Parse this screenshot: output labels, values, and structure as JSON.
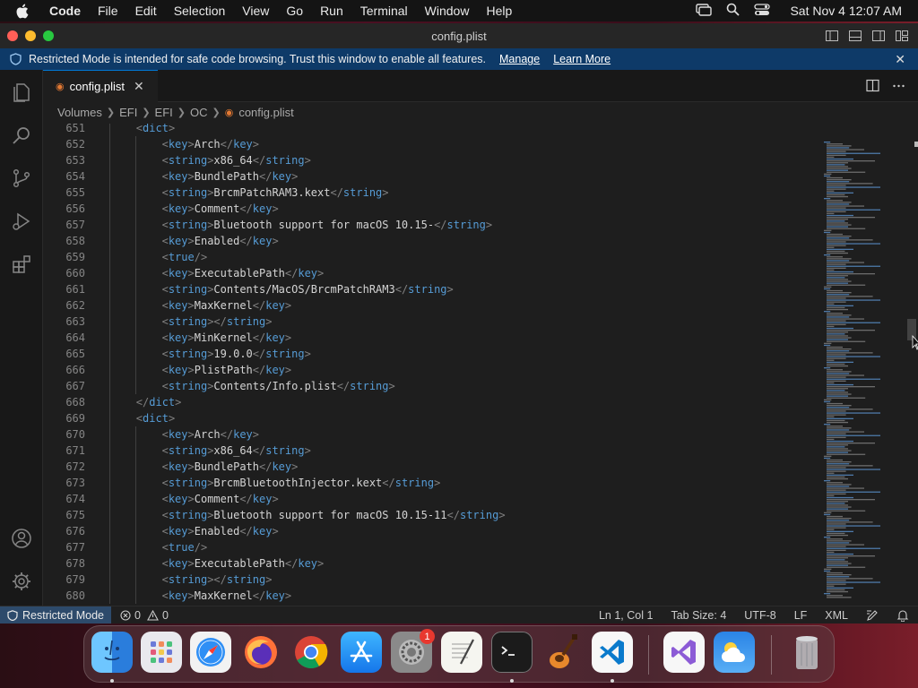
{
  "menubar": {
    "app": "Code",
    "items": [
      "File",
      "Edit",
      "Selection",
      "View",
      "Go",
      "Run",
      "Terminal",
      "Window",
      "Help"
    ],
    "clock": "Sat Nov 4  12:07 AM"
  },
  "window": {
    "title": "config.plist"
  },
  "banner": {
    "message": "Restricted Mode is intended for safe code browsing. Trust this window to enable all features.",
    "manage": "Manage",
    "learn_more": "Learn More"
  },
  "tab": {
    "label": "config.plist"
  },
  "breadcrumb": [
    "Volumes",
    "EFI",
    "EFI",
    "OC",
    "config.plist"
  ],
  "lines": [
    {
      "n": "651",
      "indent": 1,
      "parts": [
        [
          "tag",
          "<"
        ],
        [
          "tname",
          "dict"
        ],
        [
          "tag",
          ">"
        ]
      ]
    },
    {
      "n": "652",
      "indent": 2,
      "parts": [
        [
          "tag",
          "<"
        ],
        [
          "tname",
          "key"
        ],
        [
          "tag",
          ">"
        ],
        [
          "txt",
          "Arch"
        ],
        [
          "tag",
          "</"
        ],
        [
          "tname",
          "key"
        ],
        [
          "tag",
          ">"
        ]
      ]
    },
    {
      "n": "653",
      "indent": 2,
      "parts": [
        [
          "tag",
          "<"
        ],
        [
          "tname",
          "string"
        ],
        [
          "tag",
          ">"
        ],
        [
          "txt",
          "x86_64"
        ],
        [
          "tag",
          "</"
        ],
        [
          "tname",
          "string"
        ],
        [
          "tag",
          ">"
        ]
      ]
    },
    {
      "n": "654",
      "indent": 2,
      "parts": [
        [
          "tag",
          "<"
        ],
        [
          "tname",
          "key"
        ],
        [
          "tag",
          ">"
        ],
        [
          "txt",
          "BundlePath"
        ],
        [
          "tag",
          "</"
        ],
        [
          "tname",
          "key"
        ],
        [
          "tag",
          ">"
        ]
      ]
    },
    {
      "n": "655",
      "indent": 2,
      "parts": [
        [
          "tag",
          "<"
        ],
        [
          "tname",
          "string"
        ],
        [
          "tag",
          ">"
        ],
        [
          "txt",
          "BrcmPatchRAM3.kext"
        ],
        [
          "tag",
          "</"
        ],
        [
          "tname",
          "string"
        ],
        [
          "tag",
          ">"
        ]
      ]
    },
    {
      "n": "656",
      "indent": 2,
      "parts": [
        [
          "tag",
          "<"
        ],
        [
          "tname",
          "key"
        ],
        [
          "tag",
          ">"
        ],
        [
          "txt",
          "Comment"
        ],
        [
          "tag",
          "</"
        ],
        [
          "tname",
          "key"
        ],
        [
          "tag",
          ">"
        ]
      ]
    },
    {
      "n": "657",
      "indent": 2,
      "parts": [
        [
          "tag",
          "<"
        ],
        [
          "tname",
          "string"
        ],
        [
          "tag",
          ">"
        ],
        [
          "txt",
          "Bluetooth support for macOS 10.15-"
        ],
        [
          "tag",
          "</"
        ],
        [
          "tname",
          "string"
        ],
        [
          "tag",
          ">"
        ]
      ]
    },
    {
      "n": "658",
      "indent": 2,
      "parts": [
        [
          "tag",
          "<"
        ],
        [
          "tname",
          "key"
        ],
        [
          "tag",
          ">"
        ],
        [
          "txt",
          "Enabled"
        ],
        [
          "tag",
          "</"
        ],
        [
          "tname",
          "key"
        ],
        [
          "tag",
          ">"
        ]
      ]
    },
    {
      "n": "659",
      "indent": 2,
      "parts": [
        [
          "tag",
          "<"
        ],
        [
          "tname",
          "true"
        ],
        [
          "tag",
          "/>"
        ]
      ]
    },
    {
      "n": "660",
      "indent": 2,
      "parts": [
        [
          "tag",
          "<"
        ],
        [
          "tname",
          "key"
        ],
        [
          "tag",
          ">"
        ],
        [
          "txt",
          "ExecutablePath"
        ],
        [
          "tag",
          "</"
        ],
        [
          "tname",
          "key"
        ],
        [
          "tag",
          ">"
        ]
      ]
    },
    {
      "n": "661",
      "indent": 2,
      "parts": [
        [
          "tag",
          "<"
        ],
        [
          "tname",
          "string"
        ],
        [
          "tag",
          ">"
        ],
        [
          "txt",
          "Contents/MacOS/BrcmPatchRAM3"
        ],
        [
          "tag",
          "</"
        ],
        [
          "tname",
          "string"
        ],
        [
          "tag",
          ">"
        ]
      ]
    },
    {
      "n": "662",
      "indent": 2,
      "parts": [
        [
          "tag",
          "<"
        ],
        [
          "tname",
          "key"
        ],
        [
          "tag",
          ">"
        ],
        [
          "txt",
          "MaxKernel"
        ],
        [
          "tag",
          "</"
        ],
        [
          "tname",
          "key"
        ],
        [
          "tag",
          ">"
        ]
      ]
    },
    {
      "n": "663",
      "indent": 2,
      "parts": [
        [
          "tag",
          "<"
        ],
        [
          "tname",
          "string"
        ],
        [
          "tag",
          "></"
        ],
        [
          "tname",
          "string"
        ],
        [
          "tag",
          ">"
        ]
      ]
    },
    {
      "n": "664",
      "indent": 2,
      "parts": [
        [
          "tag",
          "<"
        ],
        [
          "tname",
          "key"
        ],
        [
          "tag",
          ">"
        ],
        [
          "txt",
          "MinKernel"
        ],
        [
          "tag",
          "</"
        ],
        [
          "tname",
          "key"
        ],
        [
          "tag",
          ">"
        ]
      ]
    },
    {
      "n": "665",
      "indent": 2,
      "parts": [
        [
          "tag",
          "<"
        ],
        [
          "tname",
          "string"
        ],
        [
          "tag",
          ">"
        ],
        [
          "txt",
          "19.0.0"
        ],
        [
          "tag",
          "</"
        ],
        [
          "tname",
          "string"
        ],
        [
          "tag",
          ">"
        ]
      ]
    },
    {
      "n": "666",
      "indent": 2,
      "parts": [
        [
          "tag",
          "<"
        ],
        [
          "tname",
          "key"
        ],
        [
          "tag",
          ">"
        ],
        [
          "txt",
          "PlistPath"
        ],
        [
          "tag",
          "</"
        ],
        [
          "tname",
          "key"
        ],
        [
          "tag",
          ">"
        ]
      ]
    },
    {
      "n": "667",
      "indent": 2,
      "parts": [
        [
          "tag",
          "<"
        ],
        [
          "tname",
          "string"
        ],
        [
          "tag",
          ">"
        ],
        [
          "txt",
          "Contents/Info.plist"
        ],
        [
          "tag",
          "</"
        ],
        [
          "tname",
          "string"
        ],
        [
          "tag",
          ">"
        ]
      ]
    },
    {
      "n": "668",
      "indent": 1,
      "parts": [
        [
          "tag",
          "</"
        ],
        [
          "tname",
          "dict"
        ],
        [
          "tag",
          ">"
        ]
      ]
    },
    {
      "n": "669",
      "indent": 1,
      "parts": [
        [
          "tag",
          "<"
        ],
        [
          "tname",
          "dict"
        ],
        [
          "tag",
          ">"
        ]
      ]
    },
    {
      "n": "670",
      "indent": 2,
      "parts": [
        [
          "tag",
          "<"
        ],
        [
          "tname",
          "key"
        ],
        [
          "tag",
          ">"
        ],
        [
          "txt",
          "Arch"
        ],
        [
          "tag",
          "</"
        ],
        [
          "tname",
          "key"
        ],
        [
          "tag",
          ">"
        ]
      ]
    },
    {
      "n": "671",
      "indent": 2,
      "parts": [
        [
          "tag",
          "<"
        ],
        [
          "tname",
          "string"
        ],
        [
          "tag",
          ">"
        ],
        [
          "txt",
          "x86_64"
        ],
        [
          "tag",
          "</"
        ],
        [
          "tname",
          "string"
        ],
        [
          "tag",
          ">"
        ]
      ]
    },
    {
      "n": "672",
      "indent": 2,
      "parts": [
        [
          "tag",
          "<"
        ],
        [
          "tname",
          "key"
        ],
        [
          "tag",
          ">"
        ],
        [
          "txt",
          "BundlePath"
        ],
        [
          "tag",
          "</"
        ],
        [
          "tname",
          "key"
        ],
        [
          "tag",
          ">"
        ]
      ]
    },
    {
      "n": "673",
      "indent": 2,
      "parts": [
        [
          "tag",
          "<"
        ],
        [
          "tname",
          "string"
        ],
        [
          "tag",
          ">"
        ],
        [
          "txt",
          "BrcmBluetoothInjector.kext"
        ],
        [
          "tag",
          "</"
        ],
        [
          "tname",
          "string"
        ],
        [
          "tag",
          ">"
        ]
      ]
    },
    {
      "n": "674",
      "indent": 2,
      "parts": [
        [
          "tag",
          "<"
        ],
        [
          "tname",
          "key"
        ],
        [
          "tag",
          ">"
        ],
        [
          "txt",
          "Comment"
        ],
        [
          "tag",
          "</"
        ],
        [
          "tname",
          "key"
        ],
        [
          "tag",
          ">"
        ]
      ]
    },
    {
      "n": "675",
      "indent": 2,
      "parts": [
        [
          "tag",
          "<"
        ],
        [
          "tname",
          "string"
        ],
        [
          "tag",
          ">"
        ],
        [
          "txt",
          "Bluetooth support for macOS 10.15-11"
        ],
        [
          "tag",
          "</"
        ],
        [
          "tname",
          "string"
        ],
        [
          "tag",
          ">"
        ]
      ]
    },
    {
      "n": "676",
      "indent": 2,
      "parts": [
        [
          "tag",
          "<"
        ],
        [
          "tname",
          "key"
        ],
        [
          "tag",
          ">"
        ],
        [
          "txt",
          "Enabled"
        ],
        [
          "tag",
          "</"
        ],
        [
          "tname",
          "key"
        ],
        [
          "tag",
          ">"
        ]
      ]
    },
    {
      "n": "677",
      "indent": 2,
      "parts": [
        [
          "tag",
          "<"
        ],
        [
          "tname",
          "true"
        ],
        [
          "tag",
          "/>"
        ]
      ]
    },
    {
      "n": "678",
      "indent": 2,
      "parts": [
        [
          "tag",
          "<"
        ],
        [
          "tname",
          "key"
        ],
        [
          "tag",
          ">"
        ],
        [
          "txt",
          "ExecutablePath"
        ],
        [
          "tag",
          "</"
        ],
        [
          "tname",
          "key"
        ],
        [
          "tag",
          ">"
        ]
      ]
    },
    {
      "n": "679",
      "indent": 2,
      "parts": [
        [
          "tag",
          "<"
        ],
        [
          "tname",
          "string"
        ],
        [
          "tag",
          "></"
        ],
        [
          "tname",
          "string"
        ],
        [
          "tag",
          ">"
        ]
      ]
    },
    {
      "n": "680",
      "indent": 2,
      "parts": [
        [
          "tag",
          "<"
        ],
        [
          "tname",
          "key"
        ],
        [
          "tag",
          ">"
        ],
        [
          "txt",
          "MaxKernel"
        ],
        [
          "tag",
          "</"
        ],
        [
          "tname",
          "key"
        ],
        [
          "tag",
          ">"
        ]
      ]
    }
  ],
  "statusbar": {
    "restricted": "Restricted Mode",
    "errors": "0",
    "warnings": "0",
    "position": "Ln 1, Col 1",
    "tab_size": "Tab Size: 4",
    "encoding": "UTF-8",
    "eol": "LF",
    "language": "XML"
  },
  "dock": {
    "settings_badge": "1",
    "apps": [
      "finder-icon",
      "launchpad-icon",
      "safari-icon",
      "firefox-icon",
      "chrome-icon",
      "app-store-icon",
      "system-settings-icon",
      "textedit-icon",
      "terminal-icon",
      "garageband-icon",
      "vscode-icon",
      "visual-studio-icon",
      "weather-icon",
      "trash-icon"
    ]
  },
  "colors": {
    "accent": "#0078d4",
    "banner_bg": "#0e3a68",
    "tag_name": "#569cd6",
    "tag_bracket": "#808080",
    "text": "#d4d4d4"
  }
}
